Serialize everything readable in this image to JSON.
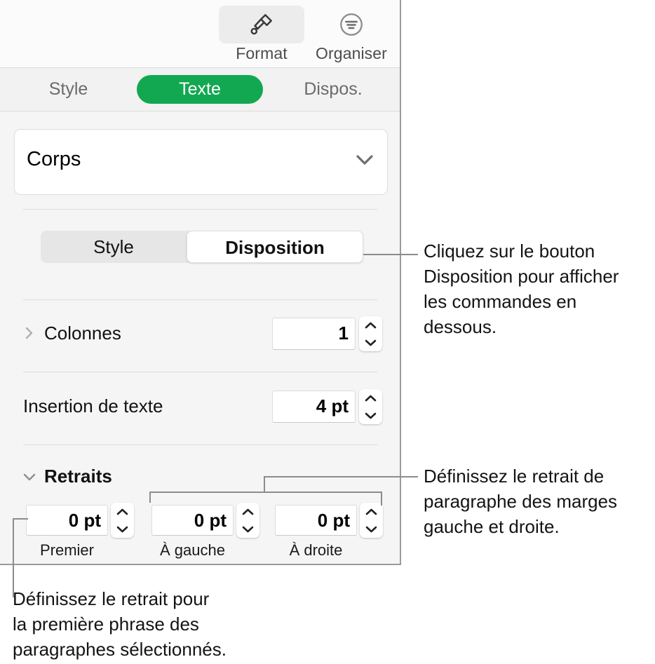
{
  "panel": {
    "toolbar": {
      "buttons": [
        {
          "label": "Format",
          "icon": "paintbrush-icon",
          "selected": true
        },
        {
          "label": "Organiser",
          "icon": "arrange-icon",
          "selected": false
        }
      ]
    },
    "tabs": [
      {
        "label": "Style",
        "active": false
      },
      {
        "label": "Texte",
        "active": true
      },
      {
        "label": "Dispos.",
        "active": false
      }
    ],
    "paragraph_style": {
      "value": "Corps",
      "icon": "chevron-down-icon"
    },
    "segmented": {
      "options": [
        {
          "label": "Style",
          "selected": false
        },
        {
          "label": "Disposition",
          "selected": true
        }
      ]
    },
    "rows": {
      "columns": {
        "label": "Colonnes",
        "value": "1",
        "disclosure": "chevron-right-icon"
      },
      "text_inset": {
        "label": "Insertion de texte",
        "value": "4 pt"
      },
      "indents": {
        "label": "Retraits",
        "disclosure": "chevron-down-icon"
      }
    },
    "indent_fields": [
      {
        "value": "0 pt",
        "caption": "Premier"
      },
      {
        "value": "0 pt",
        "caption": "À gauche"
      },
      {
        "value": "0 pt",
        "caption": "À droite"
      }
    ]
  },
  "callouts": [
    {
      "id": "layout-button",
      "text": "Cliquez sur le bouton\nDisposition pour afficher\nles commandes en\ndessous."
    },
    {
      "id": "left-right-indent",
      "text": "Définissez le retrait de\nparagraphe des marges\ngauche et droite."
    },
    {
      "id": "first-line-indent",
      "text": "Définissez le retrait pour\nla première phrase des\nparagraphes sélectionnés."
    }
  ],
  "colors": {
    "accent_green": "#12a851",
    "panel_background": "#f5f5f5",
    "leader_line": "#8c8c8c"
  }
}
